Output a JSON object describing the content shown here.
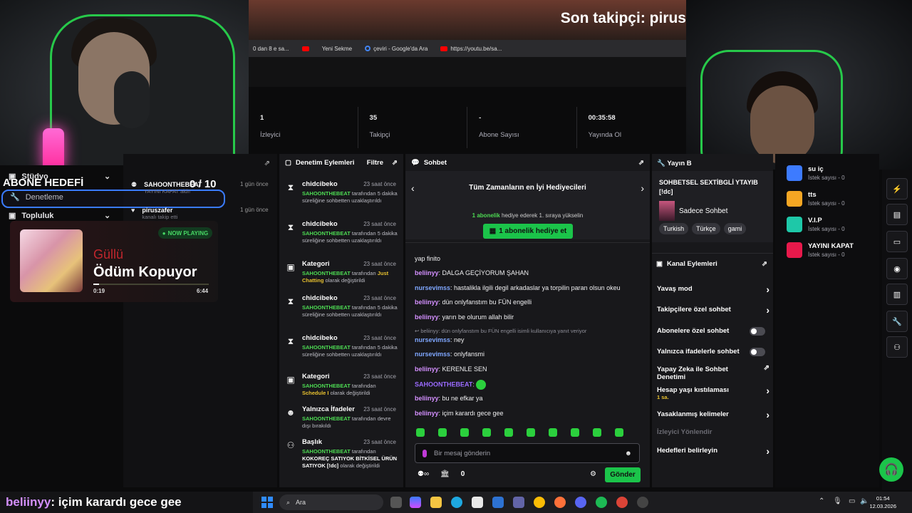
{
  "browser": {
    "follower_text": "Son takipçi: pirus",
    "bookmarks": [
      "0 dan 8 e sa...",
      "Yeni Sekme",
      "çeviri - Google'da Ara",
      "https://youtu.be/sa..."
    ]
  },
  "stats": [
    {
      "value": "1",
      "label": "İzleyici"
    },
    {
      "value": "35",
      "label": "Takipçi"
    },
    {
      "value": "-",
      "label": "Abone Sayısı"
    },
    {
      "value": "00:35:58",
      "label": "Yayında Ol"
    }
  ],
  "sidebar": {
    "goal_title": "ABONE HEDEFİ",
    "goal_count": "0 / 10",
    "studio": "Stüdyo",
    "moderation": "Denetleme",
    "community": "Topluluk"
  },
  "activity": [
    {
      "name": "SAHOONTHEBEAT",
      "sub": "YAYINI KAPAT aldı!",
      "time": "1 gün önce"
    },
    {
      "name": "piruszafer",
      "sub": "kanalı takip etti",
      "time": "1 gün önce"
    }
  ],
  "now_playing": {
    "badge": "NOW PLAYING",
    "artist": "Güllü",
    "song": "Ödüm Kopuyor",
    "elapsed": "0:19",
    "duration": "6:44",
    "progress": 0.05
  },
  "mod_panel": {
    "title": "Denetim Eylemleri",
    "filter": "Filtre",
    "items": [
      {
        "icon": "hourglass-icon",
        "glyph": "⧗",
        "title": "chidcibeko",
        "time": "23 saat önce",
        "actor": "SAHOONTHEBEAT",
        "desc": " tarafından 5 dakika süreliğine sohbetten uzaklaştırıldı"
      },
      {
        "icon": "hourglass-icon",
        "glyph": "⧗",
        "title": "chidcibeko",
        "time": "23 saat önce",
        "actor": "SAHOONTHEBEAT",
        "desc": " tarafından 5 dakika süreliğine sohbetten uzaklaştırıldı"
      },
      {
        "icon": "category-icon",
        "glyph": "▣",
        "title": "Kategori",
        "time": "23 saat önce",
        "actor": "SAHOONTHEBEAT",
        "desc": " tarafından ",
        "extra": "Just Chatting",
        "desc2": " olarak değiştirildi"
      },
      {
        "icon": "hourglass-icon",
        "glyph": "⧗",
        "title": "chidcibeko",
        "time": "23 saat önce",
        "actor": "SAHOONTHEBEAT",
        "desc": " tarafından 5 dakika süreliğine sohbetten uzaklaştırıldı"
      },
      {
        "icon": "hourglass-icon",
        "glyph": "⧗",
        "title": "chidcibeko",
        "time": "23 saat önce",
        "actor": "SAHOONTHEBEAT",
        "desc": " tarafından 5 dakika süreliğine sohbetten uzaklaştırıldı"
      },
      {
        "icon": "category-icon",
        "glyph": "▣",
        "title": "Kategori",
        "time": "23 saat önce",
        "actor": "SAHOONTHEBEAT",
        "desc": " tarafından ",
        "extra": "Schedule I",
        "desc2": " olarak değiştirildi"
      },
      {
        "icon": "emote-only-icon",
        "glyph": "☻",
        "title": "Yalnızca İfadeler",
        "time": "23 saat önce",
        "actor": "SAHOONTHEBEAT",
        "desc": " tarafından devre dışı bırakıldı"
      },
      {
        "icon": "title-icon",
        "glyph": "⚇",
        "title": "Başlık",
        "time": "23 saat önce",
        "actor": "SAHOONTHEBEAT",
        "desc": " tarafından ",
        "extra_w": "KOKOREÇ SATIYOK BİTKİSEL ÜRÜN SATIYOK [!dc]",
        "desc2": " olarak değiştirildi"
      }
    ]
  },
  "chat": {
    "title": "Sohbet",
    "gift_title": "Tüm Zamanların en İyi Hediyecileri",
    "gift_sub_strong": "1 abonelik",
    "gift_sub_rest": " hediye ederek 1. sıraya yükselin",
    "gift_button": "1 abonelik hediye et",
    "messages": [
      {
        "user": "",
        "text": "yap finito"
      },
      {
        "user": "beliinyy",
        "text": ": DALGA GEÇİYORUM ŞAHAN"
      },
      {
        "user": "nursevimss",
        "text": ": hastalikla ilgili degil arkadaslar ya torpilin paran olsun okeu"
      },
      {
        "user": "beliinyy",
        "text": ": dün onlyfanstım bu FÜN engelli"
      },
      {
        "user": "beliinyy",
        "text": ": yarın be olurum allah bilir"
      },
      {
        "user": "",
        "text": "↩ beliinyy: dün onlyfanstım bu FÜN engelli isimli kullanıcıya yanıt veriyor"
      },
      {
        "user": "nursevimss",
        "text": ": ney"
      },
      {
        "user": "nursevimss",
        "text": ": onlyfansmi"
      },
      {
        "user": "beliinyy",
        "text": ": KERENLE SEN"
      },
      {
        "user": "SAHOONTHEBEAT",
        "text": ":"
      },
      {
        "user": "beliinyy",
        "text": ": bu ne efkar ya"
      },
      {
        "user": "beliinyy",
        "text": ": içim karardı gece gee"
      }
    ],
    "input_placeholder": "Bir mesaj gönderin",
    "points": "0",
    "send": "Gönder"
  },
  "right_panel": {
    "title": "Yayın B",
    "stream_title": "SOHBETSEL SEXTİBGLİ YTAYIB [!dc]",
    "category": "Sadece Sohbet",
    "tags": [
      "Turkish",
      "Türkçe",
      "gami"
    ],
    "channel_actions": "Kanal Eylemleri",
    "actions": [
      {
        "label": "Yavaş mod",
        "type": "chevron"
      },
      {
        "label": "Takipçilere özel sohbet",
        "type": "chevron"
      },
      {
        "label": "Abonelere özel sohbet",
        "type": "toggle"
      },
      {
        "label": "Yalnızca ifadelerle sohbet",
        "type": "toggle"
      },
      {
        "label": "Yapay Zeka ile Sohbet Denetimi",
        "type": "external"
      },
      {
        "label": "Hesap yaşı kıstılaması",
        "sub": "1 sa.",
        "type": "chevron"
      },
      {
        "label": "Yasaklanmış kelimeler",
        "type": "chevron"
      },
      {
        "label": "İzleyici Yönlendir",
        "type": "disabled"
      },
      {
        "label": "Hedefleri belirleyin",
        "type": "chevron"
      }
    ]
  },
  "rewards": [
    {
      "name": "su iç",
      "count": "İstek sayısı - 0",
      "color": "#3d7bff"
    },
    {
      "name": "tts",
      "count": "İstek sayısı - 0",
      "color": "#f5a623"
    },
    {
      "name": "V.I.P",
      "count": "İstek sayısı - 0",
      "color": "#1ec8a8"
    },
    {
      "name": "YAYINI KAPAT",
      "count": "İstek sayısı - 0",
      "color": "#e8194b"
    }
  ],
  "bottom_chat": {
    "user": "beliinyy",
    "text": " : içim karardı gece gee"
  },
  "taskbar": {
    "search": "Ara",
    "time": "01:54",
    "date": "12.03.2026"
  },
  "colors": {
    "accent": "#1bc44a",
    "background": "#18181b"
  }
}
